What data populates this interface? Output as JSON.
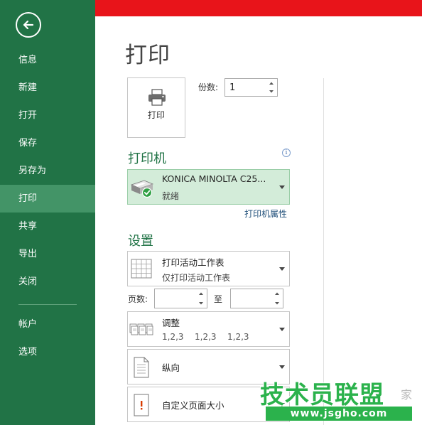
{
  "sidebar": {
    "items": [
      {
        "label": "信息"
      },
      {
        "label": "新建"
      },
      {
        "label": "打开"
      },
      {
        "label": "保存"
      },
      {
        "label": "另存为"
      },
      {
        "label": "打印"
      },
      {
        "label": "共享"
      },
      {
        "label": "导出"
      },
      {
        "label": "关闭"
      },
      {
        "label": "帐户"
      },
      {
        "label": "选项"
      }
    ],
    "active": "打印"
  },
  "page": {
    "title": "打印"
  },
  "print_button": {
    "label": "打印"
  },
  "copies": {
    "label": "份数:",
    "value": "1"
  },
  "printer": {
    "heading": "打印机",
    "info_icon": "i",
    "name": "KONICA MINOLTA C25...",
    "status": "就绪",
    "properties_link": "打印机属性"
  },
  "settings": {
    "heading": "设置",
    "scope": {
      "title": "打印活动工作表",
      "subtitle": "仅打印活动工作表"
    },
    "pages": {
      "label": "页数:",
      "to_label": "至",
      "from": "",
      "to": ""
    },
    "collate": {
      "title": "调整",
      "values": [
        "1,2,3",
        "1,2,3",
        "1,2,3"
      ]
    },
    "orientation": {
      "title": "纵向"
    },
    "paper_size": {
      "title": "自定义页面大小"
    }
  },
  "watermark": {
    "text": "技术员联盟",
    "url": "www.jsgho.com",
    "tail": "家"
  },
  "colors": {
    "sidebar": "#217346",
    "sidebar_active": "#439467",
    "accent_bar": "#e8141a",
    "heading": "#217346",
    "printer_selected_bg": "#d3ecd9"
  }
}
